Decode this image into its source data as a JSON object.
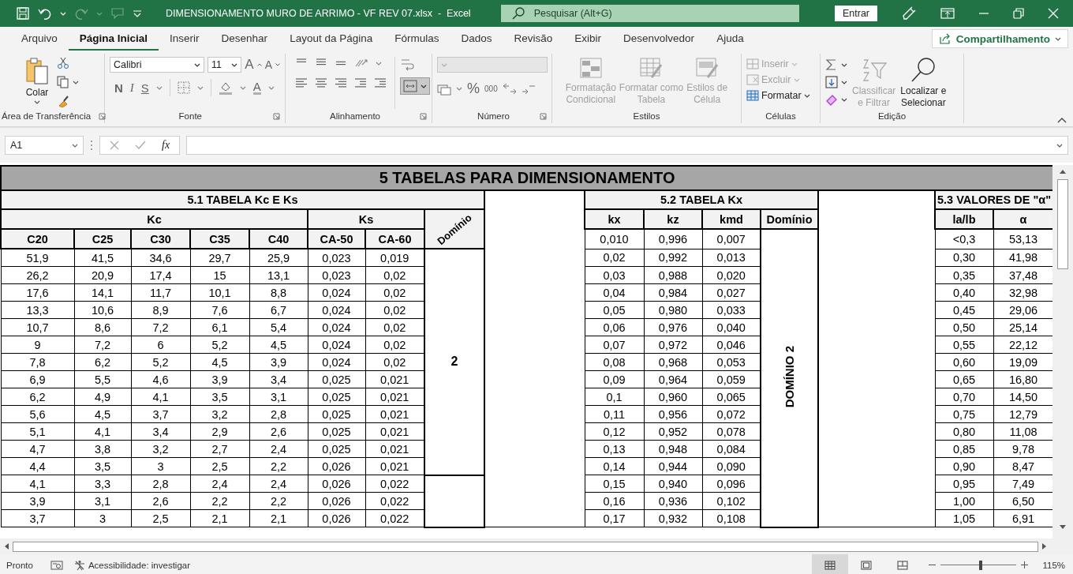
{
  "title_bar": {
    "title": "DIMENSIONAMENTO MURO DE ARRIMO - VF REV 07.xlsx  -  Excel",
    "search": {
      "placeholder": "Pesquisar (Alt+G)"
    },
    "sign_in": "Entrar"
  },
  "menu_tabs": [
    {
      "label": "Arquivo",
      "selected": false
    },
    {
      "label": "Página Inicial",
      "selected": true
    },
    {
      "label": "Inserir",
      "selected": false
    },
    {
      "label": "Desenhar",
      "selected": false
    },
    {
      "label": "Layout da Página",
      "selected": false
    },
    {
      "label": "Fórmulas",
      "selected": false
    },
    {
      "label": "Dados",
      "selected": false
    },
    {
      "label": "Revisão",
      "selected": false
    },
    {
      "label": "Exibir",
      "selected": false
    },
    {
      "label": "Desenvolvedor",
      "selected": false
    },
    {
      "label": "Ajuda",
      "selected": false
    }
  ],
  "share_button": "Compartilhamento",
  "ribbon": {
    "clipboard": {
      "label": "Área de Transferência",
      "paste": "Colar"
    },
    "font": {
      "label": "Fonte",
      "font_name": "Calibri",
      "font_size": "11",
      "grow": "A",
      "shrink": "A",
      "bold": "N",
      "italic": "I",
      "underline": "S",
      "font_color": "A"
    },
    "alignment": {
      "label": "Alinhamento",
      "merge_selected": true
    },
    "number": {
      "label": "Número",
      "percent": "%",
      "thousands": "000"
    },
    "styles": {
      "label": "Estilos",
      "buttons": [
        {
          "kind": "conditional",
          "label": "Formatação\nCondicional",
          "disabled": true
        },
        {
          "kind": "table",
          "label": "Formatar como\nTabela",
          "disabled": true
        },
        {
          "kind": "cell",
          "label": "Estilos de\nCélula",
          "disabled": true
        }
      ]
    },
    "cells": {
      "label": "Células",
      "buttons": [
        {
          "kind": "insert",
          "label": "Inserir",
          "disabled": true
        },
        {
          "kind": "delete",
          "label": "Excluir",
          "disabled": true
        },
        {
          "kind": "format",
          "label": "Formatar",
          "disabled": false
        }
      ]
    },
    "editing": {
      "label": "Edição",
      "buttons": [
        {
          "kind": "sort",
          "label": "Classificar\ne Filtrar",
          "disabled": true
        },
        {
          "kind": "find",
          "label": "Localizar e\nSelecionar",
          "disabled": false
        }
      ]
    }
  },
  "formula_bar": {
    "name_box": "A1",
    "fx": "fx"
  },
  "sheet": {
    "title": "5 TABELAS PARA DIMENSIONAMENTO",
    "table_kc_ks": {
      "title": "5.1 TABELA Kc E Ks",
      "column_groups": [
        {
          "label": "Kc",
          "columns": [
            "C20",
            "C25",
            "C30",
            "C35",
            "C40"
          ]
        },
        {
          "label": "Ks",
          "columns": [
            "CA-50",
            "CA-60"
          ]
        }
      ],
      "domain_header": "Domínio",
      "domain_groups": [
        {
          "label": "2",
          "rows": [
            [
              "51,9",
              "41,5",
              "34,6",
              "29,7",
              "25,9",
              "0,023",
              "0,019"
            ],
            [
              "26,2",
              "20,9",
              "17,4",
              "15",
              "13,1",
              "0,023",
              "0,02"
            ],
            [
              "17,6",
              "14,1",
              "11,7",
              "10,1",
              "8,8",
              "0,024",
              "0,02"
            ],
            [
              "13,3",
              "10,6",
              "8,9",
              "7,6",
              "6,7",
              "0,024",
              "0,02"
            ],
            [
              "10,7",
              "8,6",
              "7,2",
              "6,1",
              "5,4",
              "0,024",
              "0,02"
            ],
            [
              "9",
              "7,2",
              "6",
              "5,2",
              "4,5",
              "0,024",
              "0,02"
            ],
            [
              "7,8",
              "6,2",
              "5,2",
              "4,5",
              "3,9",
              "0,024",
              "0,02"
            ],
            [
              "6,9",
              "5,5",
              "4,6",
              "3,9",
              "3,4",
              "0,025",
              "0,021"
            ],
            [
              "6,2",
              "4,9",
              "4,1",
              "3,5",
              "3,1",
              "0,025",
              "0,021"
            ],
            [
              "5,6",
              "4,5",
              "3,7",
              "3,2",
              "2,8",
              "0,025",
              "0,021"
            ],
            [
              "5,1",
              "4,1",
              "3,4",
              "2,9",
              "2,6",
              "0,025",
              "0,021"
            ],
            [
              "4,7",
              "3,8",
              "3,2",
              "2,7",
              "2,4",
              "0,025",
              "0,021"
            ],
            [
              "4,4",
              "3,5",
              "3",
              "2,5",
              "2,2",
              "0,026",
              "0,021"
            ]
          ]
        },
        {
          "rows": [
            [
              "4,1",
              "3,3",
              "2,8",
              "2,4",
              "2,4",
              "0,026",
              "0,022"
            ],
            [
              "3,9",
              "3,1",
              "2,6",
              "2,2",
              "2,2",
              "0,026",
              "0,022"
            ],
            [
              "3,7",
              "3",
              "2,5",
              "2,1",
              "2,1",
              "0,026",
              "0,022"
            ]
          ]
        }
      ]
    },
    "table_kx": {
      "title": "5.2 TABELA Kx",
      "columns": [
        "kx",
        "kz",
        "kmd",
        "Domínio"
      ],
      "domain_groups": [
        {
          "label": "DOMÍNIO 2",
          "rows": [
            [
              "0,010",
              "0,996",
              "0,007"
            ],
            [
              "0,02",
              "0,992",
              "0,013"
            ],
            [
              "0,03",
              "0,988",
              "0,020"
            ],
            [
              "0,04",
              "0,984",
              "0,027"
            ],
            [
              "0,05",
              "0,980",
              "0,033"
            ],
            [
              "0,06",
              "0,976",
              "0,040"
            ],
            [
              "0,07",
              "0,972",
              "0,046"
            ],
            [
              "0,08",
              "0,968",
              "0,053"
            ],
            [
              "0,09",
              "0,964",
              "0,059"
            ],
            [
              "0,1",
              "0,960",
              "0,065"
            ],
            [
              "0,11",
              "0,956",
              "0,072"
            ],
            [
              "0,12",
              "0,952",
              "0,078"
            ],
            [
              "0,13",
              "0,948",
              "0,084"
            ],
            [
              "0,14",
              "0,944",
              "0,090"
            ],
            [
              "0,15",
              "0,940",
              "0,096"
            ],
            [
              "0,16",
              "0,936",
              "0,102"
            ],
            [
              "0,17",
              "0,932",
              "0,108"
            ]
          ]
        }
      ]
    },
    "table_alpha": {
      "title": "5.3 VALORES DE \"α\"",
      "columns": [
        "la/lb",
        "α"
      ],
      "rows": [
        [
          "<0,3",
          "53,13"
        ],
        [
          "0,30",
          "41,98"
        ],
        [
          "0,35",
          "37,48"
        ],
        [
          "0,40",
          "32,98"
        ],
        [
          "0,45",
          "29,06"
        ],
        [
          "0,50",
          "25,14"
        ],
        [
          "0,55",
          "22,12"
        ],
        [
          "0,60",
          "19,09"
        ],
        [
          "0,65",
          "16,80"
        ],
        [
          "0,70",
          "14,50"
        ],
        [
          "0,75",
          "12,79"
        ],
        [
          "0,80",
          "11,08"
        ],
        [
          "0,85",
          "9,78"
        ],
        [
          "0,90",
          "8,47"
        ],
        [
          "0,95",
          "7,49"
        ],
        [
          "1,00",
          "6,50"
        ],
        [
          "1,05",
          "6,91"
        ]
      ]
    }
  },
  "status_bar": {
    "status": "Pronto",
    "accessibility": "Acessibilidade: investigar",
    "views": [
      {
        "kind": "normal",
        "selected": true
      },
      {
        "kind": "page-layout",
        "selected": false
      },
      {
        "kind": "page-break",
        "selected": false
      }
    ],
    "zoom_slider": {
      "level": 0.53
    },
    "zoom": "115%"
  }
}
